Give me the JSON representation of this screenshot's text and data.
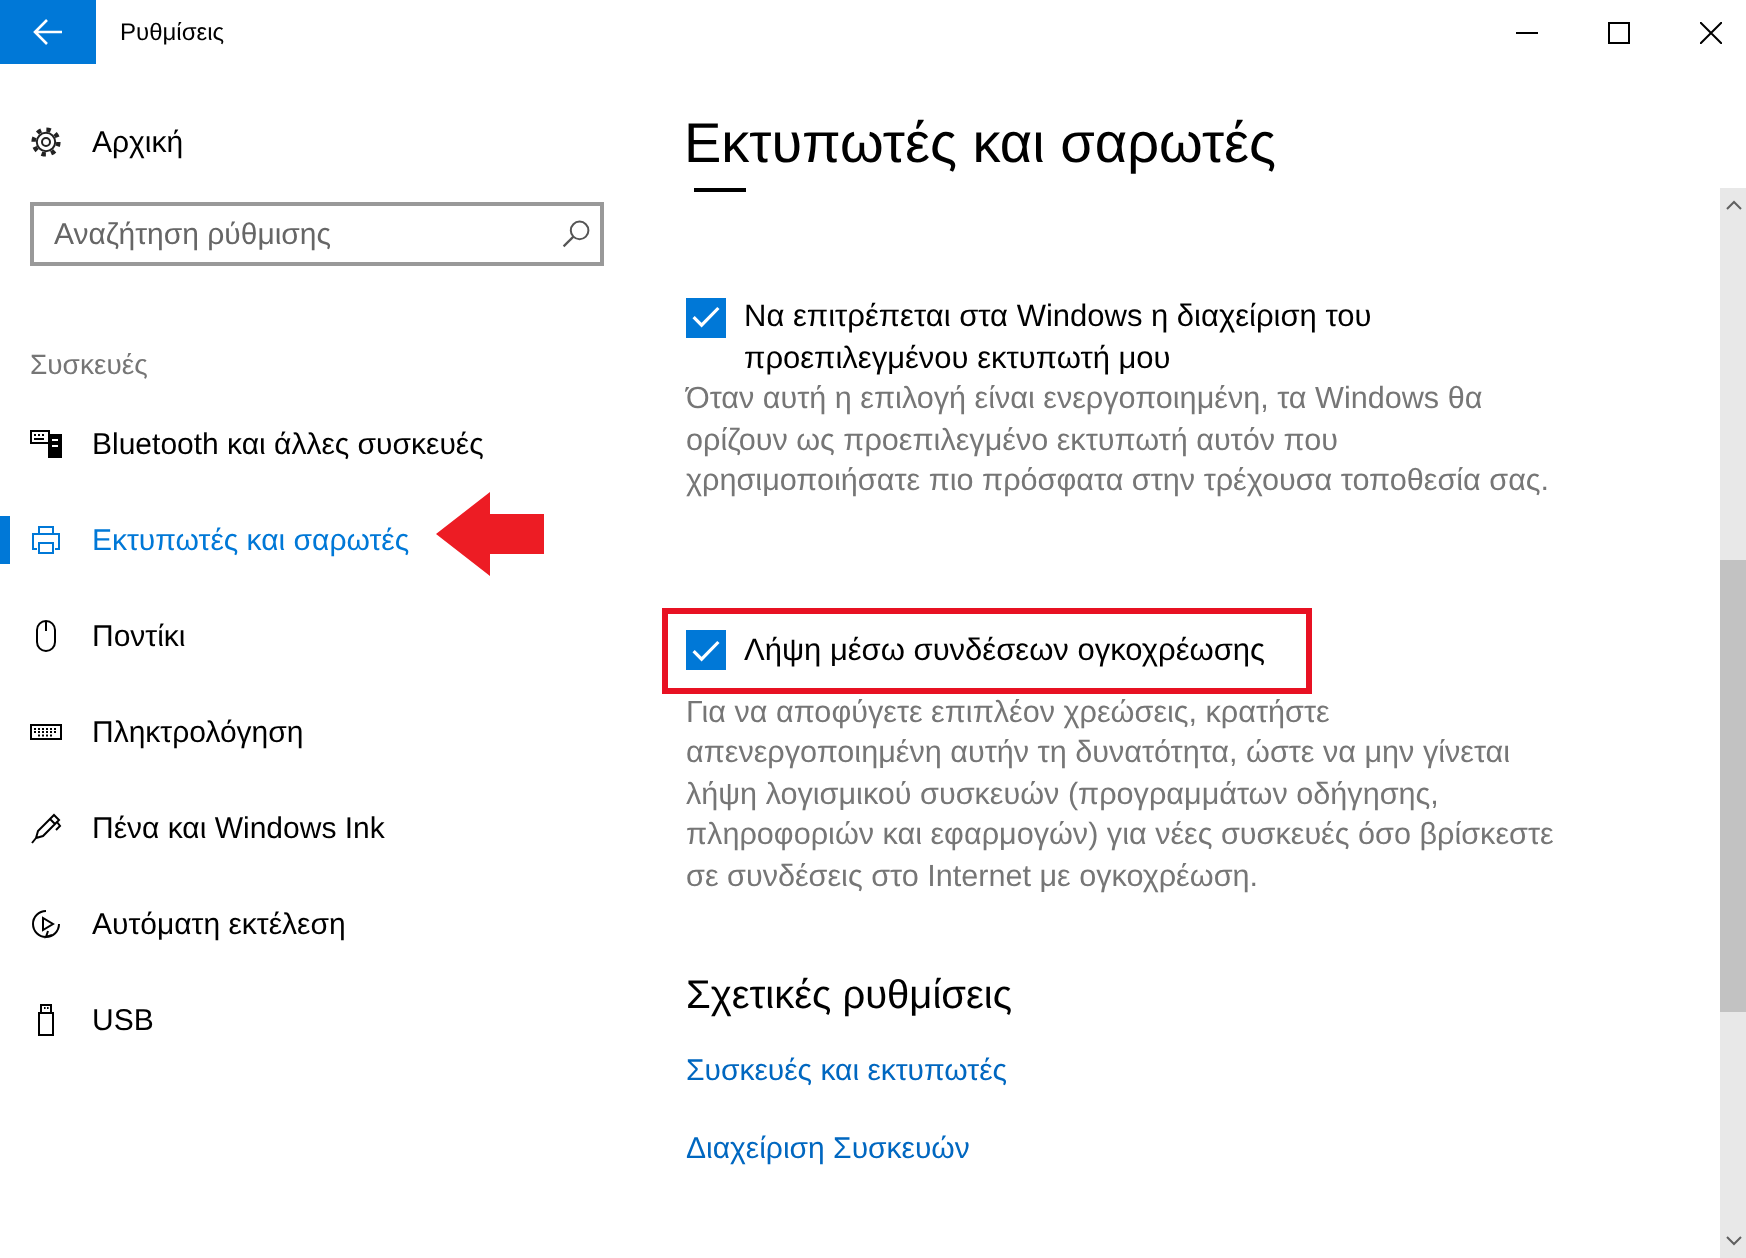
{
  "window": {
    "title": "Ρυθμίσεις"
  },
  "sidebar": {
    "home": "Αρχική",
    "search": {
      "placeholder": "Αναζήτηση ρύθμισης"
    },
    "section": "Συσκευές",
    "items": [
      {
        "label": "Bluetooth και άλλες συσκευές",
        "selected": false,
        "annotated": false
      },
      {
        "label": "Εκτυπωτές και σαρωτές",
        "selected": true,
        "annotated": true
      },
      {
        "label": "Ποντίκι",
        "selected": false,
        "annotated": false
      },
      {
        "label": "Πληκτρολόγηση",
        "selected": false,
        "annotated": false
      },
      {
        "label": "Πένα και Windows Ink",
        "selected": false,
        "annotated": false
      },
      {
        "label": "Αυτόματη εκτέλεση",
        "selected": false,
        "annotated": false
      },
      {
        "label": "USB",
        "selected": false,
        "annotated": false
      }
    ]
  },
  "page": {
    "title": "Εκτυπωτές και σαρωτές",
    "settings": [
      {
        "label": "Να επιτρέπεται στα Windows η διαχείριση του\nπροεπιλεγμένου εκτυπωτή μου",
        "checked": true,
        "annotated": false,
        "description": "Όταν αυτή η επιλογή είναι ενεργοποιημένη, τα Windows θα\nορίζουν ως προεπιλεγμένο εκτυπωτή αυτόν που\nχρησιμοποιήσατε πιο πρόσφατα στην τρέχουσα τοποθεσία σας."
      },
      {
        "label": "Λήψη μέσω συνδέσεων ογκοχρέωσης",
        "checked": true,
        "annotated": true,
        "description": "Για να αποφύγετε επιπλέον χρεώσεις, κρατήστε\nαπενεργοποιημένη αυτήν τη δυνατότητα, ώστε να μην γίνεται\nλήψη λογισμικού συσκευών (προγραμμάτων οδήγησης,\nπληροφοριών και εφαρμογών) για νέες συσκευές όσο βρίσκεστε\nσε συνδέσεις στο Internet με ογκοχρέωση."
      }
    ],
    "related": {
      "heading": "Σχετικές ρυθμίσεις",
      "links": [
        "Συσκευές και εκτυπωτές",
        "Διαχείριση Συσκευών"
      ]
    }
  }
}
